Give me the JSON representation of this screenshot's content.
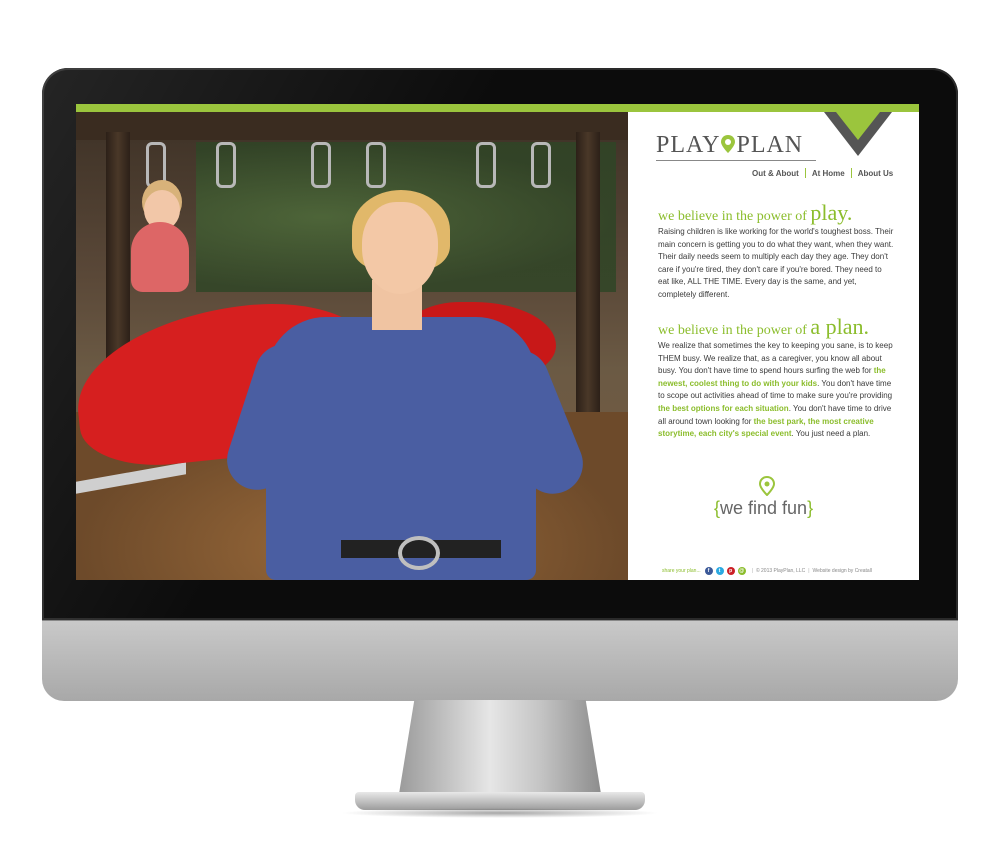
{
  "brand": {
    "logo_left": "PLAY",
    "logo_right": "PLAN",
    "accent": "#9bc53d",
    "text_green": "#8bbd2c",
    "chevron_color": "#555555"
  },
  "nav": {
    "items": [
      "Out & About",
      "At Home",
      "About Us"
    ]
  },
  "section1": {
    "heading_small": "we believe in the power of",
    "heading_big": "play.",
    "body": "Raising children is like working for the world's toughest boss. Their main concern is getting you to do what they want, when they want. Their daily needs seem to multiply each day they age. They don't care if you're tired, they don't care if you're bored. They need to eat like, ALL THE TIME. Every day is the same, and yet, completely different."
  },
  "section2": {
    "heading_small": "we believe in the power of",
    "heading_big": "a plan.",
    "body": {
      "p1": "We realize that sometimes the key to keeping you sane, is to keep THEM busy. We realize that, as a caregiver, you know all about busy. You don't have time to spend hours surfing the web for ",
      "h1": "the newest, coolest thing to do with your kids",
      "p2": ". You don't have time to scope out activities ahead of time to make sure you're providing ",
      "h2": "the best options for each situation",
      "p3": ". You don't have time to drive all around town looking for ",
      "h3": "the best park, the most creative storytime, each city's special event",
      "p4": ". You just need a plan."
    }
  },
  "tagline": {
    "open": "{",
    "text": "we find fun",
    "close": "}"
  },
  "footer": {
    "share": "share your plan...",
    "social": [
      {
        "name": "facebook",
        "glyph": "f",
        "color": "#3b5998"
      },
      {
        "name": "twitter",
        "glyph": "t",
        "color": "#2ba9e1"
      },
      {
        "name": "pinterest",
        "glyph": "p",
        "color": "#cb2027"
      },
      {
        "name": "email",
        "glyph": "@",
        "color": "#8bbd2c"
      }
    ],
    "copyright": "© 2013 PlayPlan, LLC",
    "credit": "Website design by Creatall"
  }
}
